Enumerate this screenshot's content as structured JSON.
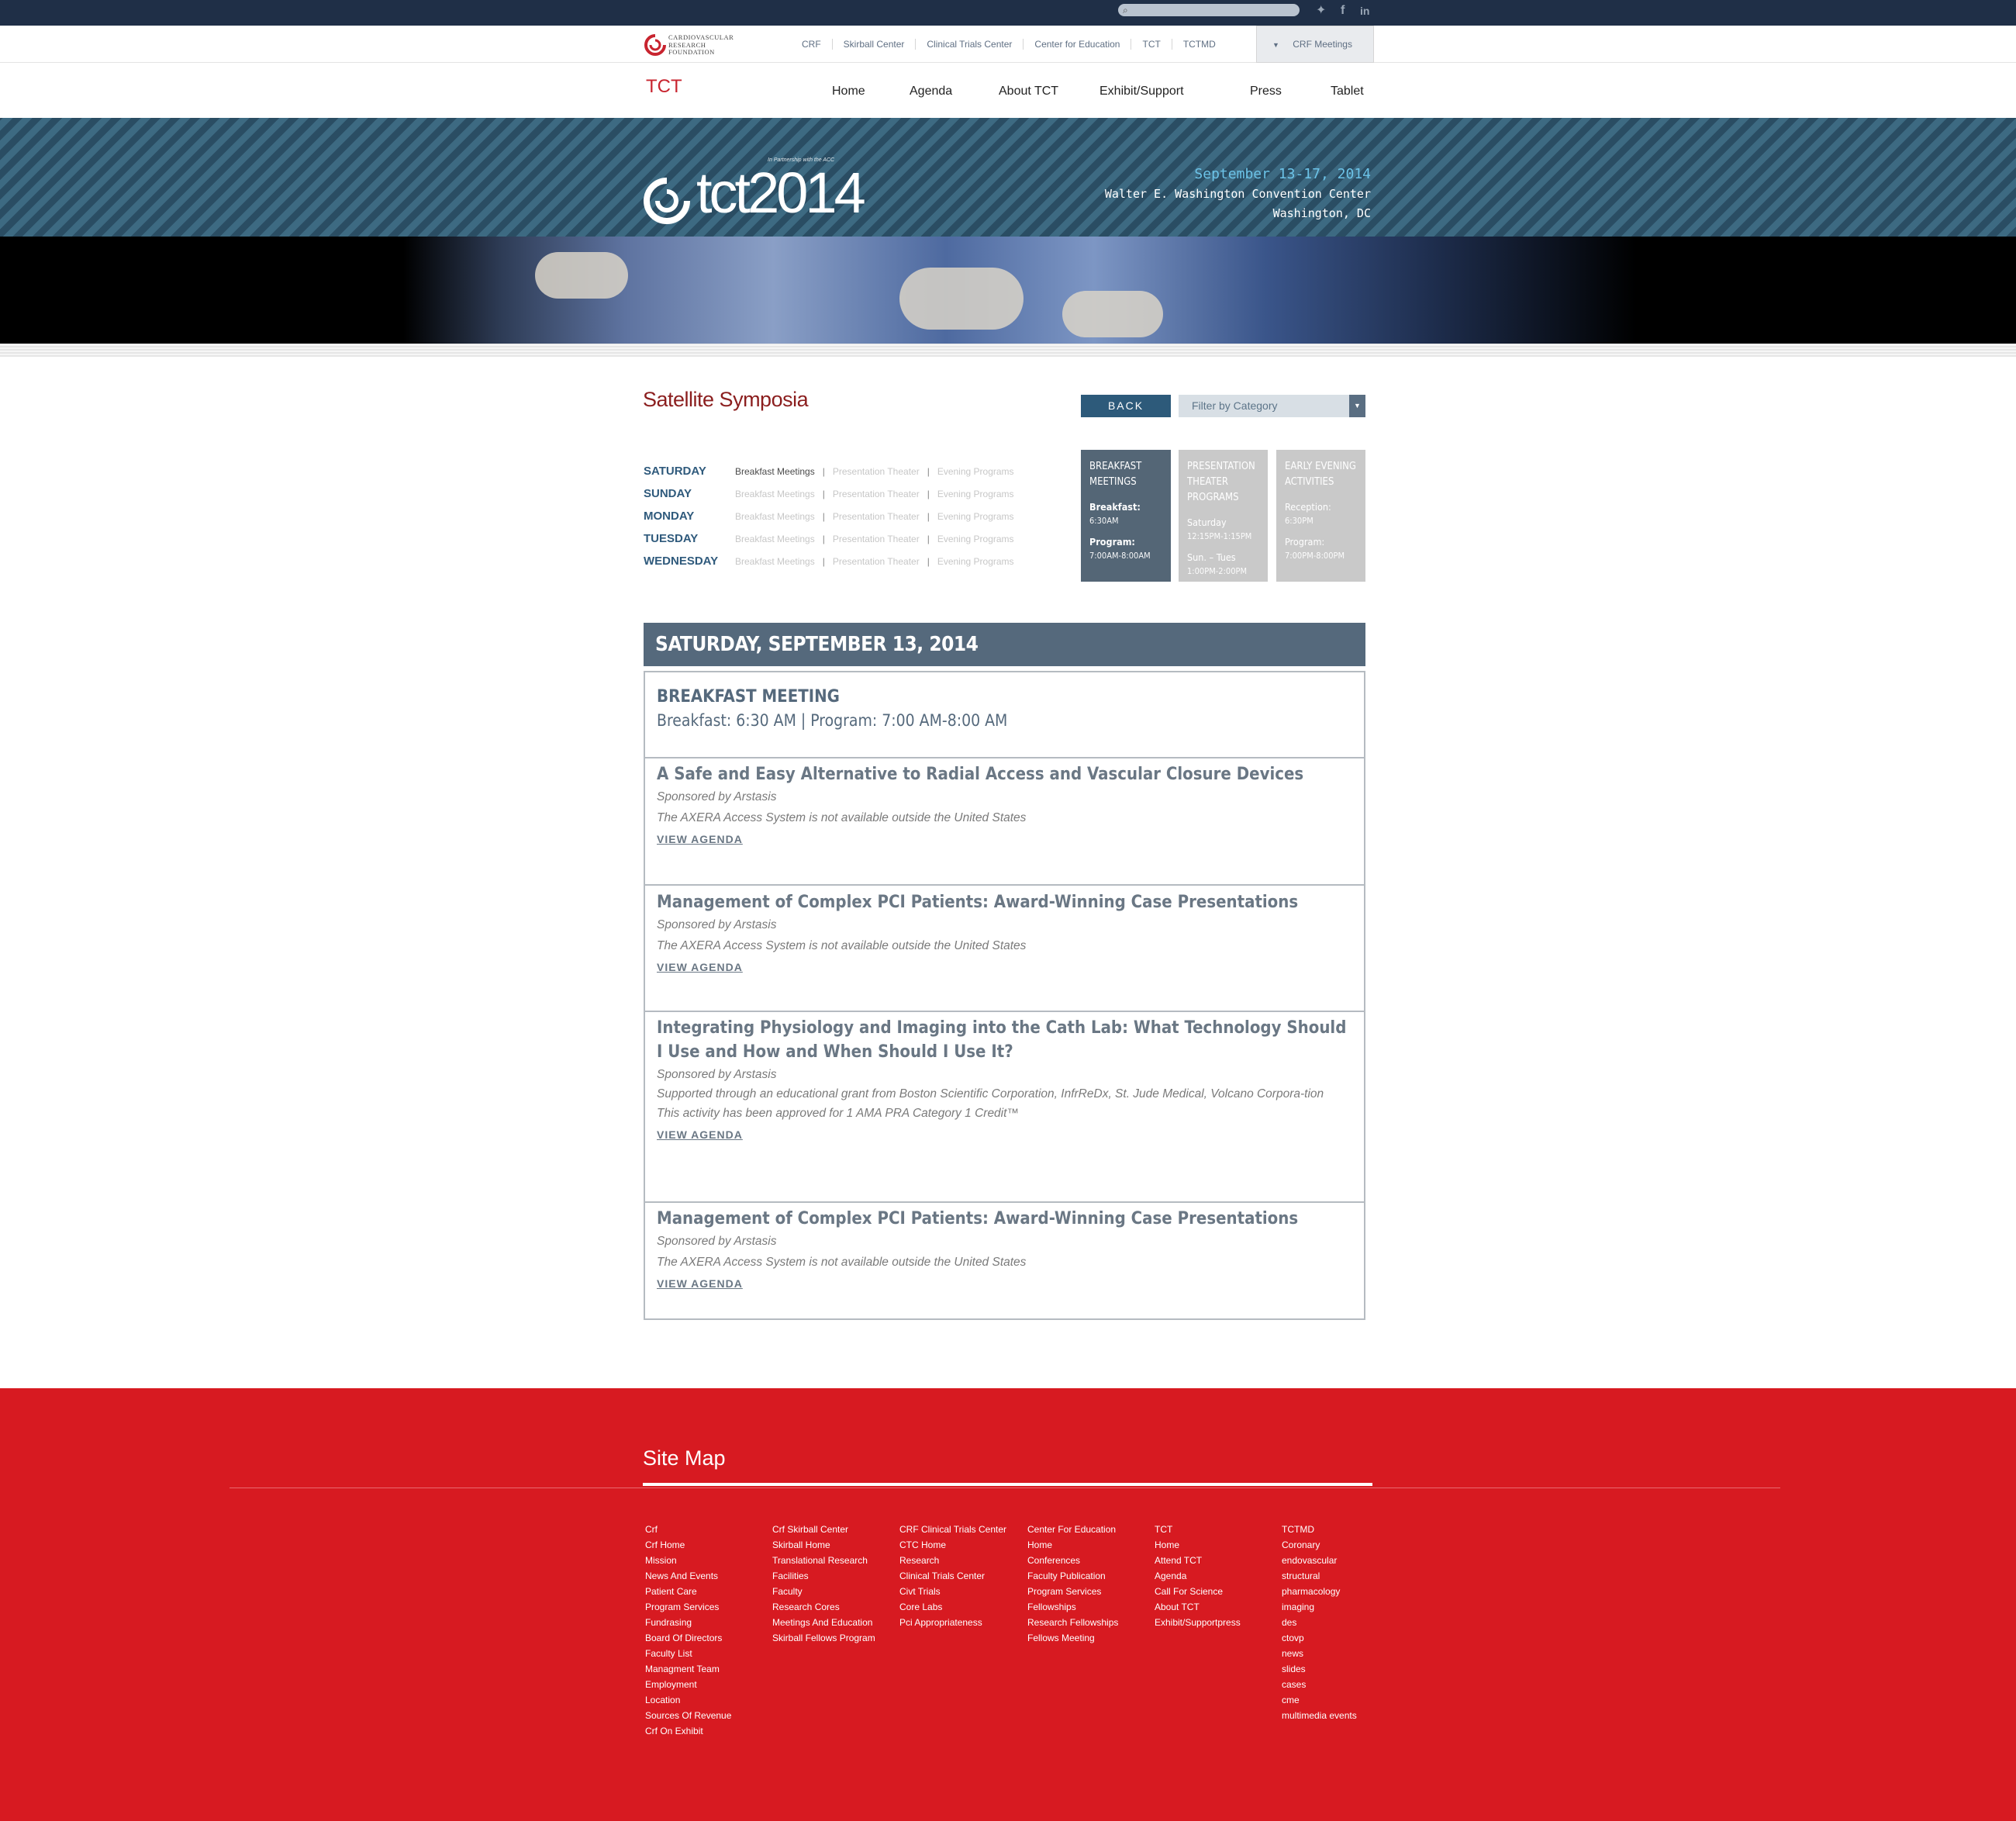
{
  "topbar": {
    "search_placeholder": "",
    "social": [
      {
        "icon": "twitter-icon",
        "glyph": "🐦"
      },
      {
        "icon": "facebook-icon",
        "glyph": "f"
      },
      {
        "icon": "linkedin-icon",
        "glyph": "in"
      }
    ]
  },
  "sitenav": {
    "logo_text": [
      "CARDIOVASCULAR",
      "RESEARCH",
      "FOUNDATION"
    ],
    "links": [
      "CRF",
      "Skirball Center",
      "Clinical Trials Center",
      "Center for Education",
      "TCT",
      "TCTMD"
    ],
    "meetings_label": "CRF Meetings"
  },
  "mainnav": {
    "brand": "TCT",
    "items": [
      "Home",
      "Agenda",
      "About TCT",
      "Exhibit/Support",
      "Press",
      "Tablet"
    ]
  },
  "hero": {
    "logo_word": "tct2014",
    "partner": "In Partnership with the ACC",
    "date": "September 13-17, 2014",
    "venue": "Walter E. Washington Convention Center",
    "city": "Washington, DC"
  },
  "page": {
    "title": "Satellite Symposia",
    "back_label": "BACK",
    "filter_label": "Filter by Category"
  },
  "days": [
    {
      "day": "SATURDAY",
      "active": true
    },
    {
      "day": "SUNDAY",
      "active": false
    },
    {
      "day": "MONDAY",
      "active": false
    },
    {
      "day": "TUESDAY",
      "active": false
    },
    {
      "day": "WEDNESDAY",
      "active": false
    }
  ],
  "day_links": [
    "Breakfast Meetings",
    "Presentation Theater",
    "Evening Programs"
  ],
  "categories": [
    {
      "title": "Breakfast Meetings",
      "rows": [
        {
          "label": "Breakfast:",
          "value": "6:30AM"
        },
        {
          "label": "Program:",
          "value": "7:00AM-8:00AM"
        }
      ]
    },
    {
      "title": "Presentation Theater Programs",
      "rows": [
        {
          "label": "Saturday",
          "value": "12:15PM-1:15PM"
        },
        {
          "label": "Sun. – Tues",
          "value": "1:00PM-2:00PM"
        }
      ]
    },
    {
      "title": "Early Evening Activities",
      "rows": [
        {
          "label": "Reception:",
          "value": "6:30PM"
        },
        {
          "label": "Program:",
          "value": "7:00PM-8:00PM"
        }
      ]
    }
  ],
  "schedule": {
    "day_header": "SATURDAY, SEPTEMBER 13, 2014",
    "meeting_title": "BREAKFAST MEETING",
    "meeting_time": "Breakfast: 6:30 AM | Program: 7:00 AM-8:00 AM",
    "view_agenda": "VIEW AGENDA",
    "sessions": [
      {
        "title": "A Safe and Easy Alternative to Radial Access and Vascular Closure Devices",
        "sponsor": "Sponsored by Arstasis",
        "notes": [
          "The AXERA Access System is not available outside the United States"
        ]
      },
      {
        "title": "Management of Complex PCI Patients: Award-Winning Case Presentations",
        "sponsor": "Sponsored by Arstasis",
        "notes": [
          "The AXERA Access System is not available outside the United States"
        ]
      },
      {
        "title": "Integrating Physiology and Imaging into the Cath Lab: What Technology Should I Use and How and When Should I Use It?",
        "sponsor": "Sponsored by Arstasis",
        "notes": [
          "Supported through an educational grant from Boston Scientific Corporation, InfrReDx, St. Jude Medical, Volcano Corpora-tion",
          "This activity has been approved for 1 AMA PRA Category 1 Credit™"
        ]
      },
      {
        "title": "Management of Complex PCI Patients: Award-Winning Case Presentations",
        "sponsor": "Sponsored by Arstasis",
        "notes": [
          "The AXERA Access System is not available outside the United States"
        ]
      }
    ]
  },
  "footer": {
    "title": "Site Map",
    "columns": [
      [
        "Crf",
        "Crf Home",
        "Mission",
        "News And Events",
        "Patient Care",
        "Program Services",
        "Fundrasing",
        "Board Of Directors",
        "Faculty List",
        "Managment Team",
        "Employment",
        "Location",
        "Sources Of Revenue",
        "Crf On Exhibit"
      ],
      [
        "Crf Skirball Center",
        "Skirball Home",
        "Translational Research",
        "Facilities",
        "Faculty",
        "Research Cores",
        "Meetings And Education",
        "Skirball Fellows Program"
      ],
      [
        "CRF Clinical Trials Center",
        "CTC Home",
        "Research",
        "Clinical Trials Center",
        "Civt Trials",
        "Core Labs",
        "Pci Appropriateness"
      ],
      [
        "Center For Education",
        "Home",
        "Conferences",
        "Faculty Publication",
        "Program Services",
        "Fellowships",
        "Research Fellowships",
        "Fellows Meeting"
      ],
      [
        "TCT",
        "Home",
        "Attend TCT",
        "Agenda",
        "Call For Science",
        "About TCT",
        "Exhibit/Supportpress"
      ],
      [
        "TCTMD",
        "Coronary",
        "endovascular",
        "structural",
        "pharmacology",
        "imaging",
        "des",
        "ctovp",
        "news",
        "slides",
        "cases",
        "cme",
        "multimedia events"
      ]
    ]
  }
}
